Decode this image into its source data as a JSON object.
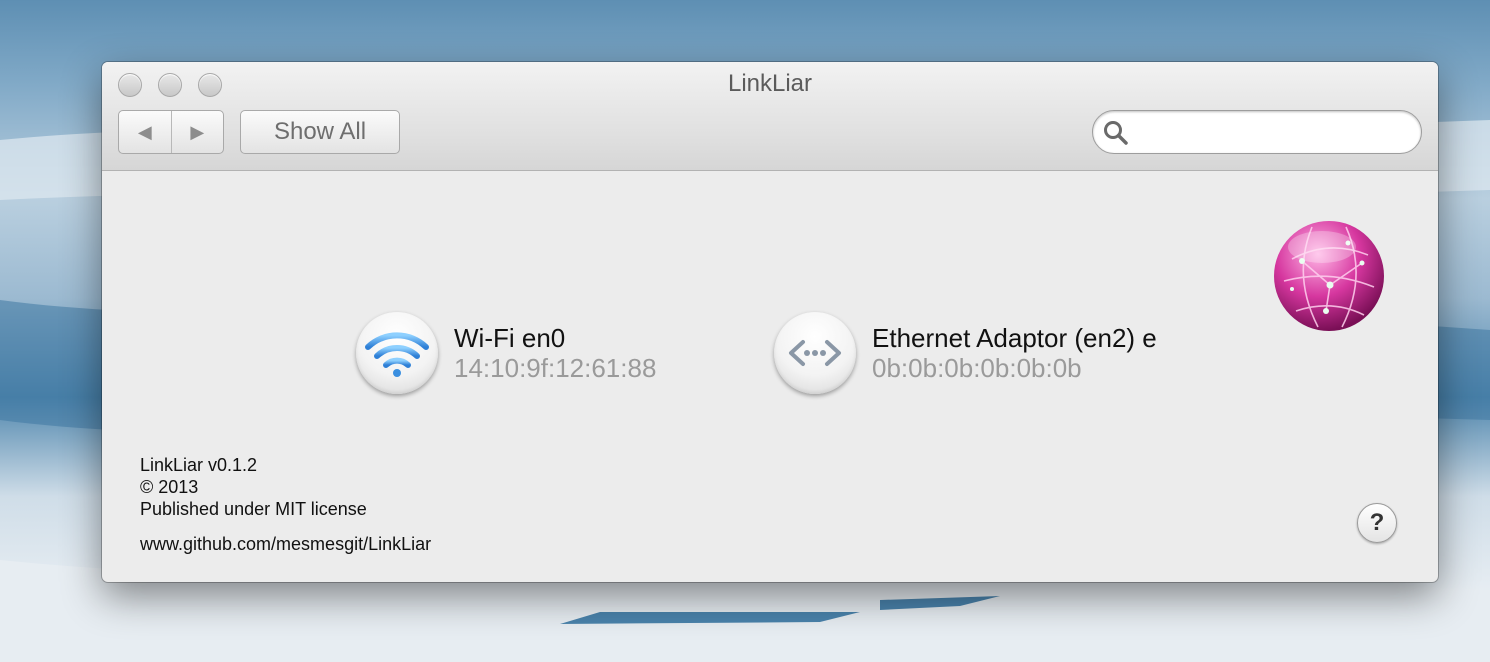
{
  "window": {
    "title": "LinkLiar"
  },
  "toolbar": {
    "back_glyph": "◀",
    "forward_glyph": "▶",
    "show_all_label": "Show All",
    "search_placeholder": "",
    "search_value": ""
  },
  "interfaces": [
    {
      "name": "Wi-Fi en0",
      "address": "14:10:9f:12:61:88",
      "icon": "wifi-icon"
    },
    {
      "name": "Ethernet Adaptor (en2) e",
      "address": "0b:0b:0b:0b:0b:0b",
      "icon": "ethernet-icon"
    }
  ],
  "footer": {
    "version": "LinkLiar v0.1.2",
    "copyright": "© 2013",
    "license": "Published under MIT license",
    "url": "www.github.com/mesmesgit/LinkLiar"
  },
  "help": {
    "label": "?"
  },
  "colors": {
    "globe": "#d6379f",
    "wifi": "#3a8fe0"
  }
}
